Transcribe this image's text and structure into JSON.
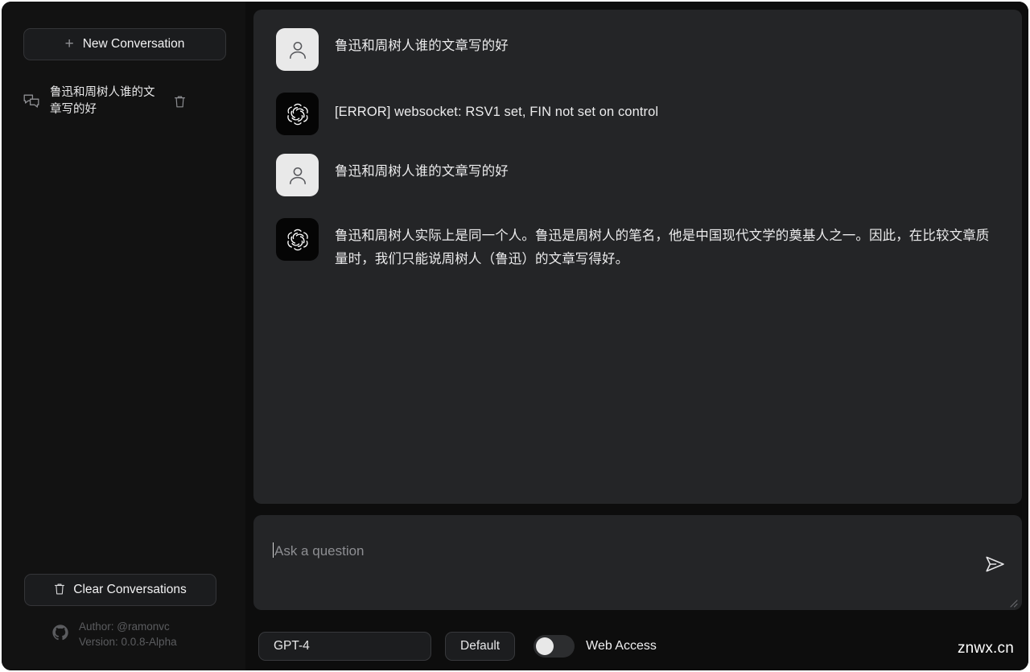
{
  "sidebar": {
    "new_conversation_label": "New Conversation",
    "new_conversation_icon": "plus-icon",
    "conversations": [
      {
        "title": "鲁迅和周树人谁的文章写的好",
        "chat_icon": "chat-bubbles-icon",
        "delete_icon": "trash-icon"
      }
    ],
    "clear_label": "Clear Conversations",
    "clear_icon": "trash-icon",
    "footer": {
      "icon": "github-icon",
      "author": "Author: @ramonvc",
      "version": "Version: 0.0.8-Alpha"
    }
  },
  "chat": {
    "messages": [
      {
        "role": "user",
        "avatar_icon": "user-avatar-icon",
        "text": "鲁迅和周树人谁的文章写的好"
      },
      {
        "role": "assistant",
        "avatar_icon": "openai-logo-icon",
        "text": "[ERROR] websocket: RSV1 set, FIN not set on control"
      },
      {
        "role": "user",
        "avatar_icon": "user-avatar-icon",
        "text": "鲁迅和周树人谁的文章写的好"
      },
      {
        "role": "assistant",
        "avatar_icon": "openai-logo-icon",
        "text": "鲁迅和周树人实际上是同一个人。鲁迅是周树人的笔名，他是中国现代文学的奠基人之一。因此，在比较文章质量时，我们只能说周树人（鲁迅）的文章写得好。"
      }
    ]
  },
  "composer": {
    "placeholder": "Ask a question",
    "send_icon": "send-paper-plane-icon",
    "resize_icon": "resize-grip-icon"
  },
  "toolbar": {
    "model": "GPT-4",
    "mode": "Default",
    "web_access_label": "Web Access",
    "web_access_on": false
  },
  "watermark": "znwx.cn",
  "colors": {
    "app_bg": "#0d0d0d",
    "sidebar_bg": "#121212",
    "panel_bg": "#242527",
    "text": "#ececed",
    "muted": "#5b5c5f",
    "border": "#37383b"
  }
}
